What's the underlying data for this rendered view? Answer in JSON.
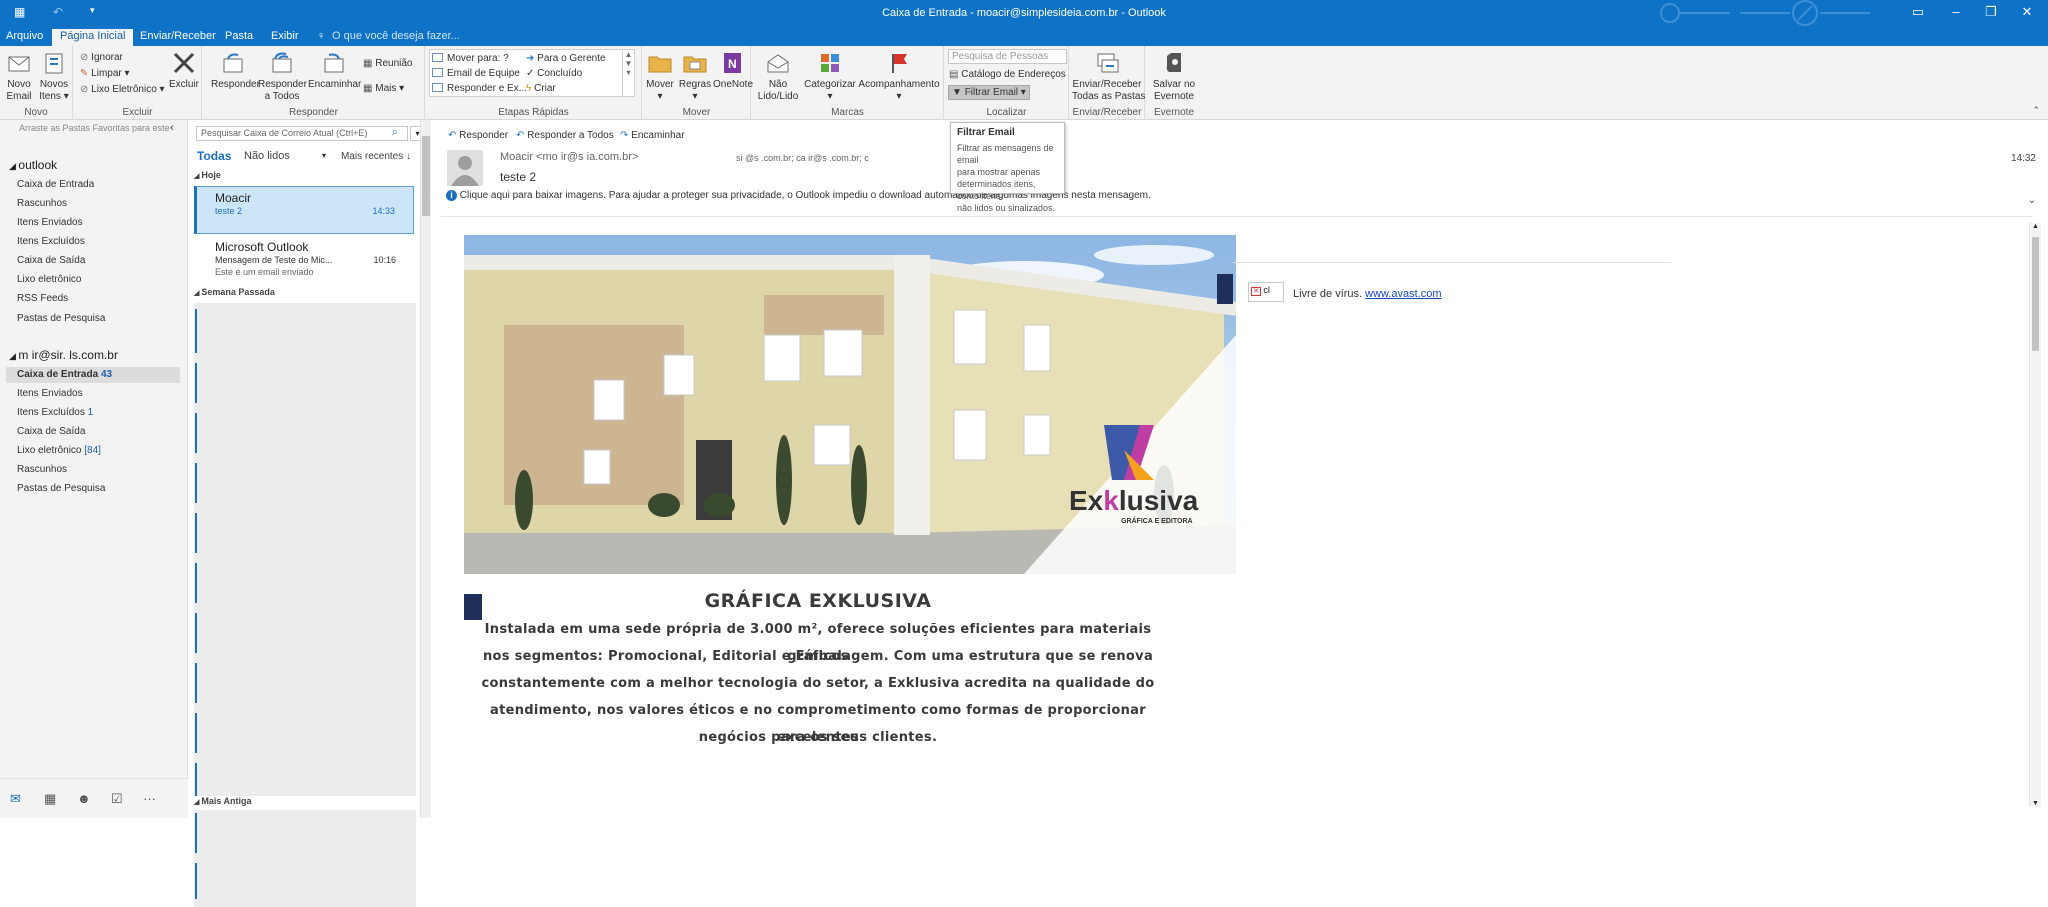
{
  "window": {
    "title": "Caixa de Entrada - moacir@simplesideia.com.br - Outlook"
  },
  "tabs": [
    "Arquivo",
    "Página Inicial",
    "Enviar/Receber",
    "Pasta",
    "Exibir"
  ],
  "tell_me": "O que você deseja fazer...",
  "ribbon": {
    "novo": {
      "novo_email": [
        "Novo",
        "Email"
      ],
      "novos_itens": [
        "Novos",
        "Itens"
      ],
      "label": "Novo"
    },
    "excluir": {
      "ignorar": "Ignorar",
      "limpar": "Limpar",
      "lixo": "Lixo Eletrônico",
      "excluir": "Excluir",
      "label": "Excluir"
    },
    "responder": {
      "responder": "Responder",
      "responder_todos": [
        "Responder",
        "a Todos"
      ],
      "encaminhar": "Encaminhar",
      "reuniao": "Reunião",
      "mais": "Mais",
      "label": "Responder"
    },
    "etapas": {
      "items": [
        "Mover para: ?",
        "Email de Equipe",
        "Responder e Ex...",
        "Para o Gerente",
        "Concluído",
        "Criar"
      ],
      "label": "Etapas Rápidas"
    },
    "mover": {
      "mover": "Mover",
      "regras": "Regras",
      "onenote": "OneNote",
      "label": "Mover"
    },
    "marcas": {
      "nao_lido": [
        "Não",
        "Lido/Lido"
      ],
      "categorizar": "Categorizar",
      "acompanhamento": "Acompanhamento",
      "label": "Marcas"
    },
    "localizar": {
      "pesquisa_pessoas": "Pesquisa de Pessoas",
      "catalogo": "Catálogo de Endereços",
      "filtrar": "Filtrar Email",
      "label": "Localizar"
    },
    "enviar": {
      "btn": [
        "Enviar/Receber",
        "Todas as Pastas"
      ],
      "label": "Enviar/Receber"
    },
    "evernote": {
      "btn": [
        "Salvar no",
        "Evernote"
      ],
      "label": "Evernote"
    }
  },
  "tooltip": {
    "title": "Filtrar Email",
    "lines": [
      "Filtrar as mensagens de email",
      "para mostrar apenas",
      "determinados itens, como itens",
      "não lidos ou sinalizados."
    ]
  },
  "favorites_hint": "Arraste as Pastas Favoritas para este",
  "folders": {
    "account1": "outlook",
    "account1_items": [
      "Caixa de Entrada",
      "Rascunhos",
      "Itens Enviados",
      "Itens Excluídos",
      "Caixa de Saída",
      "Lixo eletrônico",
      "RSS Feeds",
      "Pastas de Pesquisa"
    ],
    "account2": "m   ir@sir.        ls.com.br",
    "account2_items": [
      {
        "name": "Caixa de Entrada",
        "count": "43"
      },
      {
        "name": "Itens Enviados",
        "count": ""
      },
      {
        "name": "Itens Excluídos",
        "count": "1"
      },
      {
        "name": "Caixa de Saída",
        "count": ""
      },
      {
        "name": "Lixo eletrônico",
        "count": "[84]"
      },
      {
        "name": "Rascunhos",
        "count": ""
      },
      {
        "name": "Pastas de Pesquisa",
        "count": ""
      }
    ]
  },
  "search": {
    "placeholder": "Pesquisar Caixa de Correio Atual (Ctrl+E)"
  },
  "list": {
    "filter_all": "Todas",
    "filter_unread": "Não lidos",
    "sort": "Mais recentes",
    "group_today": "Hoje",
    "group_last_week": "Semana Passada",
    "group_older": "Mais Antiga",
    "messages": [
      {
        "sender": "Moacir",
        "subject": "teste 2",
        "time": "14:33",
        "preview": ""
      },
      {
        "sender": "Microsoft Outlook",
        "subject": "Mensagem de Teste do Mic...",
        "time": "10:16",
        "preview": "Este é um email enviado"
      }
    ]
  },
  "reading": {
    "actions": [
      "Responder",
      "Responder a Todos",
      "Encaminhar"
    ],
    "from": "Moacir <mo   ir@s         ia.com.br>",
    "to": "si     @s        .com.br; ca   ir@s          .com.br; c",
    "subject": "teste 2",
    "time": "14:32",
    "info_bar": "Clique aqui para baixar imagens. Para ajudar a proteger sua privacidade, o Outlook impediu o download automático de algumas imagens nesta mensagem.",
    "virus_text": "Livre de vírus.",
    "virus_link": "www.avast.com",
    "logo_text_1": "Ex",
    "logo_text_2": "k",
    "logo_text_3": "lusiva",
    "logo_sub": "GRÁFICA E EDITORA",
    "heading": "GRÁFICA EXKLUSIVA",
    "paragraph_lines": [
      "Instalada em uma sede própria de 3.000 m², oferece soluções eficientes para materiais gráficos",
      "nos segmentos: Promocional, Editorial e Embalagem. Com uma estrutura que se renova",
      "constantemente com a melhor tecnologia do setor, a Exklusiva acredita na qualidade do",
      "atendimento, nos valores éticos e no comprometimento como formas de proporcionar excelentes",
      "negócios para os seus clientes."
    ]
  }
}
